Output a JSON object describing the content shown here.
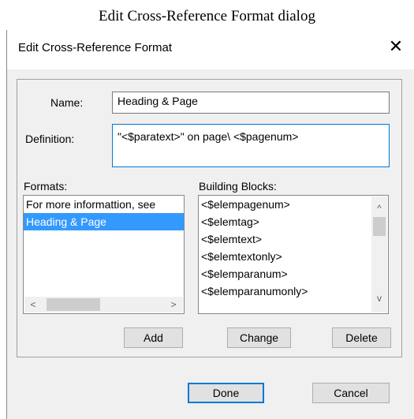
{
  "caption": "Edit Cross-Reference Format dialog",
  "dialog": {
    "title": "Edit Cross-Reference Format",
    "close_glyph": "✕"
  },
  "name": {
    "label": "Name:",
    "value": "Heading & Page"
  },
  "definition": {
    "label": "Definition:",
    "value": "\"<$paratext>\" on page\\ <$pagenum>"
  },
  "formats": {
    "label": "Formats:",
    "items": [
      "For more informattion, see",
      "Heading & Page"
    ],
    "selected_index": 1,
    "scroll_left": "<",
    "scroll_right": ">"
  },
  "building_blocks": {
    "label": "Building Blocks:",
    "items": [
      "<$elempagenum>",
      "<$elemtag>",
      "<$elemtext>",
      "<$elemtextonly>",
      "<$elemparanum>",
      "<$elemparanumonly>"
    ],
    "scroll_up": "^",
    "scroll_down": "v"
  },
  "buttons": {
    "add": "Add",
    "change": "Change",
    "delete": "Delete",
    "done": "Done",
    "cancel": "Cancel"
  }
}
